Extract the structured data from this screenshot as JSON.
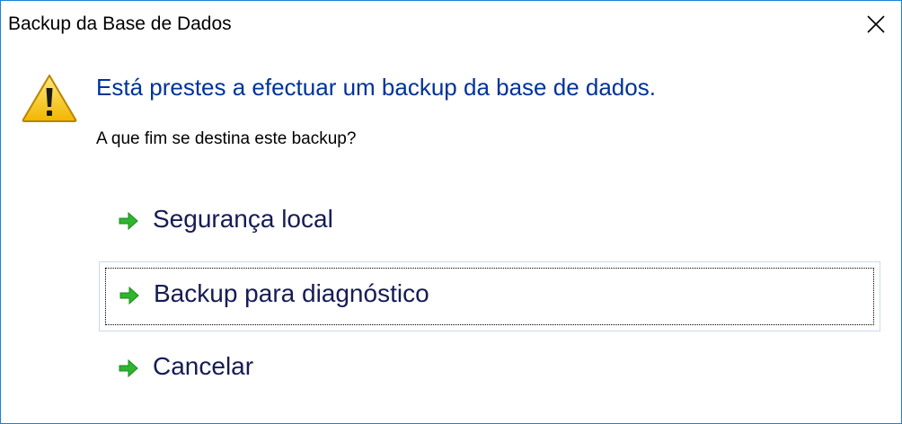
{
  "window": {
    "title": "Backup da Base de Dados",
    "close_icon": "close-icon"
  },
  "dialog": {
    "icon": "warning-icon",
    "main_instruction": "Está prestes a efectuar um backup da base de dados.",
    "content": "A que fim se destina este backup?",
    "accent_color": "#003399",
    "options": [
      {
        "label": "Segurança local",
        "icon": "green-arrow-icon",
        "focused": false
      },
      {
        "label": "Backup para diagnóstico",
        "icon": "green-arrow-icon",
        "focused": true
      },
      {
        "label": "Cancelar",
        "icon": "green-arrow-icon",
        "focused": false
      }
    ]
  }
}
